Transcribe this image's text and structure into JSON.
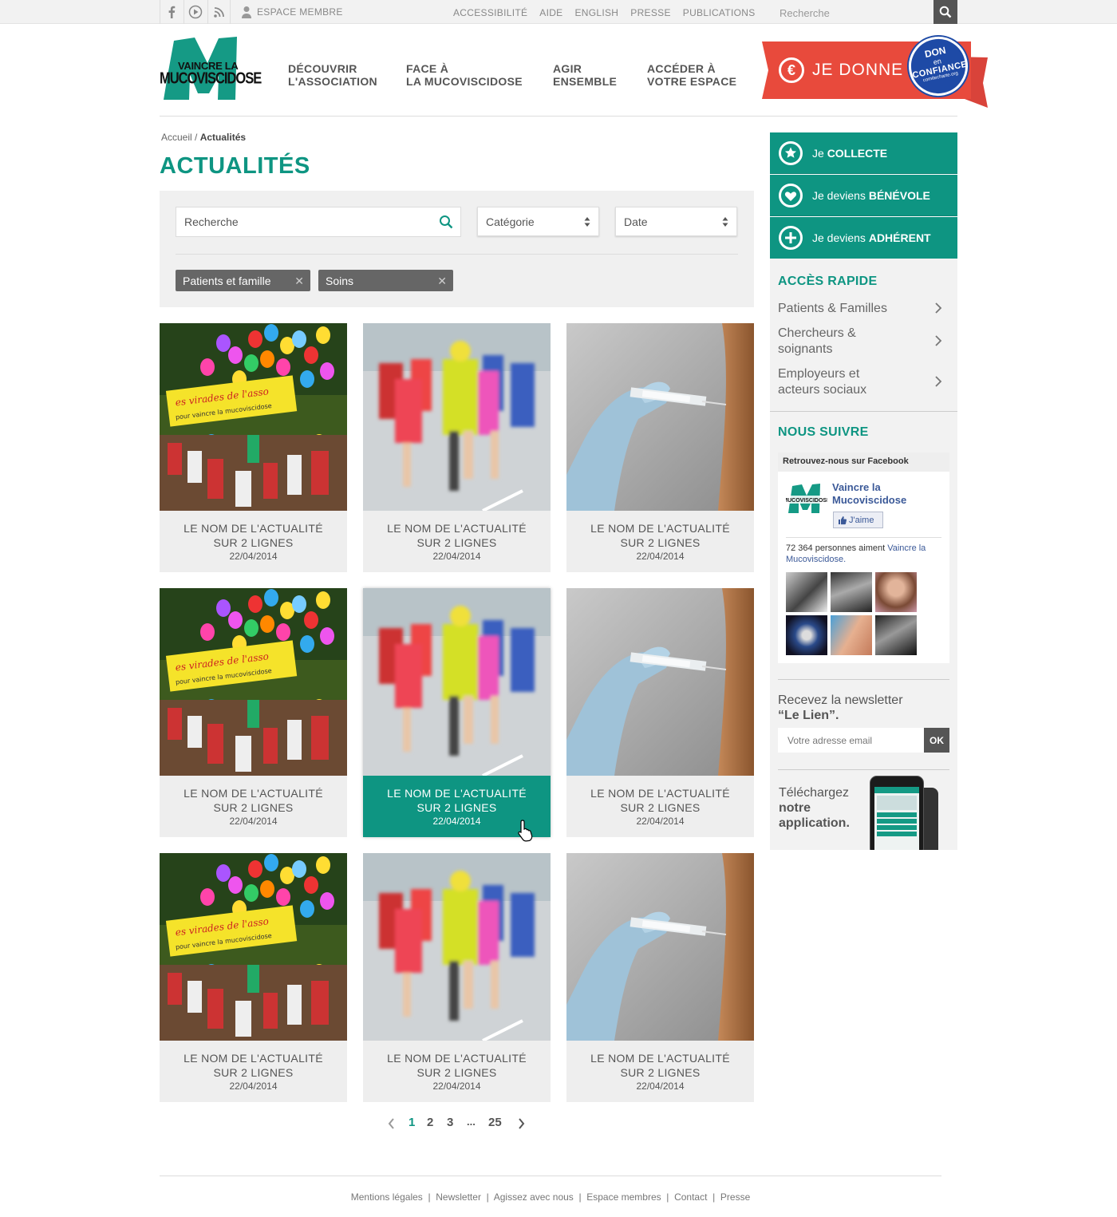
{
  "topbar": {
    "member_label": "ESPACE MEMBRE",
    "links": [
      "ACCESSIBILITÉ",
      "AIDE",
      "ENGLISH",
      "PRESSE",
      "PUBLICATIONS"
    ],
    "search_placeholder": "Recherche"
  },
  "header": {
    "logo_line1": "VAINCRE LA",
    "logo_line2": "MUCOVISCIDOSE",
    "nav": [
      {
        "line1": "DÉCOUVRIR",
        "line2": "L'ASSOCIATION"
      },
      {
        "line1": "FACE À",
        "line2": "LA MUCOVISCIDOSE"
      },
      {
        "line1": "AGIR",
        "line2": "ENSEMBLE"
      },
      {
        "line1": "ACCÉDER À",
        "line2": "VOTRE ESPACE"
      }
    ],
    "donate_label": "JE DONNE",
    "seal_line1": "DON",
    "seal_line2": "en",
    "seal_line3": "CONFIANCE",
    "seal_line4": "comitecharte.org"
  },
  "breadcrumb": {
    "home": "Accueil",
    "sep": " / ",
    "current": "Actualités"
  },
  "page_title": "ACTUALITÉS",
  "filter": {
    "search_placeholder": "Recherche",
    "category_label": "Catégorie",
    "date_label": "Date",
    "tags": [
      "Patients et famille",
      "Soins"
    ]
  },
  "cards": [
    {
      "title1": "LE NOM DE L'ACTUALITÉ",
      "title2": "SUR 2 LIGNES",
      "date": "22/04/2014",
      "image": "balloons"
    },
    {
      "title1": "LE NOM DE L'ACTUALITÉ",
      "title2": "SUR 2 LIGNES",
      "date": "22/04/2014",
      "image": "runners"
    },
    {
      "title1": "LE NOM DE L'ACTUALITÉ",
      "title2": "SUR 2 LIGNES",
      "date": "22/04/2014",
      "image": "syringe"
    },
    {
      "title1": "LE NOM DE L'ACTUALITÉ",
      "title2": "SUR 2 LIGNES",
      "date": "22/04/2014",
      "image": "balloons"
    },
    {
      "title1": "LE NOM DE L'ACTUALITÉ",
      "title2": "SUR 2 LIGNES",
      "date": "22/04/2014",
      "image": "runners",
      "active": true
    },
    {
      "title1": "LE NOM DE L'ACTUALITÉ",
      "title2": "SUR 2 LIGNES",
      "date": "22/04/2014",
      "image": "syringe"
    },
    {
      "title1": "LE NOM DE L'ACTUALITÉ",
      "title2": "SUR 2 LIGNES",
      "date": "22/04/2014",
      "image": "balloons"
    },
    {
      "title1": "LE NOM DE L'ACTUALITÉ",
      "title2": "SUR 2 LIGNES",
      "date": "22/04/2014",
      "image": "runners"
    },
    {
      "title1": "LE NOM DE L'ACTUALITÉ",
      "title2": "SUR 2 LIGNES",
      "date": "22/04/2014",
      "image": "syringe"
    }
  ],
  "pagination": {
    "pages": [
      "1",
      "2",
      "3",
      "...",
      "25"
    ],
    "current": "1"
  },
  "sidebar": {
    "actions": [
      {
        "prefix": "Je ",
        "strong": "COLLECTE",
        "icon": "star-icon"
      },
      {
        "prefix": "Je deviens ",
        "strong": "BÉNÉVOLE",
        "icon": "heart-icon"
      },
      {
        "prefix": "Je deviens ",
        "strong": "ADHÉRENT",
        "icon": "plus-icon"
      }
    ],
    "quick_title": "ACCÈS RAPIDE",
    "quick_links": [
      {
        "line1": "Patients & Familles",
        "line2": ""
      },
      {
        "line1": "Chercheurs &",
        "line2": "soignants"
      },
      {
        "line1": "Employeurs et",
        "line2": "acteurs sociaux"
      }
    ],
    "follow_title": "NOUS SUIVRE",
    "facebook": {
      "header": "Retrouvez-nous sur Facebook",
      "page_name1": "Vaincre la",
      "page_name2": "Mucoviscidose",
      "like_label": "J'aime",
      "count_text": "72 364 personnes aiment ",
      "count_link1": "Vaincre la",
      "count_link2": "Mucoviscidose."
    },
    "newsletter_line1": "Recevez la newsletter",
    "newsletter_line2": "“Le Lien”.",
    "email_placeholder": "Votre adresse email",
    "ok_label": "OK",
    "app_line1": "Téléchargez",
    "app_line2": "notre",
    "app_line3": "application."
  },
  "footer": {
    "links": [
      "Mentions légales",
      "Newsletter",
      "Agissez avec nous",
      "Espace membres",
      "Contact",
      "Presse"
    ]
  },
  "colors": {
    "brand": "#0e9582",
    "donate": "#e84a3c",
    "seal": "#1e4aa6"
  }
}
